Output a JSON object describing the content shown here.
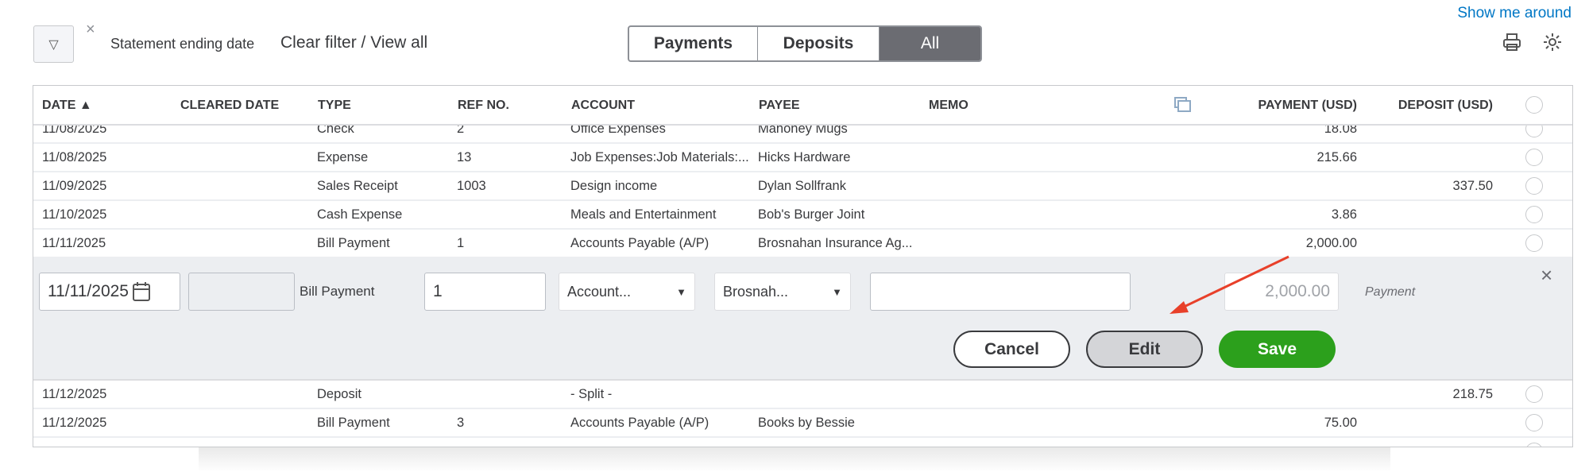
{
  "toolbar": {
    "filter_icon": "funnel-icon",
    "clear_x": "×",
    "statement_label": "Statement ending date",
    "clear_filter": "Clear filter / View all",
    "show_me_around": "Show me around",
    "print_icon": "printer-icon",
    "settings_icon": "gear-icon"
  },
  "segments": [
    {
      "label": "Payments",
      "active": false
    },
    {
      "label": "Deposits",
      "active": false
    },
    {
      "label": "All",
      "active": true
    }
  ],
  "columns": {
    "date": "DATE ▲",
    "cleared": "CLEARED DATE",
    "type": "TYPE",
    "ref": "REF NO.",
    "account": "ACCOUNT",
    "payee": "PAYEE",
    "memo": "MEMO",
    "payment": "PAYMENT (USD)",
    "deposit": "DEPOSIT (USD)"
  },
  "rows_top": [
    {
      "date": "11/08/2025",
      "type": "Check",
      "ref": "2",
      "account": "Office Expenses",
      "payee": "Mahoney Mugs",
      "payment": "18.08",
      "deposit": ""
    },
    {
      "date": "11/08/2025",
      "type": "Expense",
      "ref": "13",
      "account": "Job Expenses:Job Materials:...",
      "payee": "Hicks Hardware",
      "payment": "215.66",
      "deposit": ""
    },
    {
      "date": "11/09/2025",
      "type": "Sales Receipt",
      "ref": "1003",
      "account": "Design income",
      "payee": "Dylan Sollfrank",
      "payment": "",
      "deposit": "337.50"
    },
    {
      "date": "11/10/2025",
      "type": "Cash Expense",
      "ref": "",
      "account": "Meals and Entertainment",
      "payee": "Bob's Burger Joint",
      "payment": "3.86",
      "deposit": ""
    },
    {
      "date": "11/11/2025",
      "type": "Bill Payment",
      "ref": "1",
      "account": "Accounts Payable (A/P)",
      "payee": "Brosnahan Insurance Ag...",
      "payment": "2,000.00",
      "deposit": ""
    }
  ],
  "edit_row": {
    "date": "11/11/2025",
    "cleared": "",
    "type": "Bill Payment",
    "ref": "1",
    "account": "Account...",
    "payee": "Brosnah...",
    "memo": "",
    "amount": "2,000.00",
    "amount_label": "Payment",
    "cancel": "Cancel",
    "edit": "Edit",
    "save": "Save",
    "close": "×"
  },
  "rows_bottom": [
    {
      "date": "11/12/2025",
      "type": "Deposit",
      "ref": "",
      "account": "- Split -",
      "payee": "",
      "payment": "",
      "deposit": "218.75"
    },
    {
      "date": "11/12/2025",
      "type": "Bill Payment",
      "ref": "3",
      "account": "Accounts Payable (A/P)",
      "payee": "Books by Bessie",
      "payment": "75.00",
      "deposit": ""
    }
  ],
  "colors": {
    "save": "#2ca01c",
    "link": "#0077c5",
    "active_segment": "#6b6c72",
    "arrow": "#e8402a"
  }
}
